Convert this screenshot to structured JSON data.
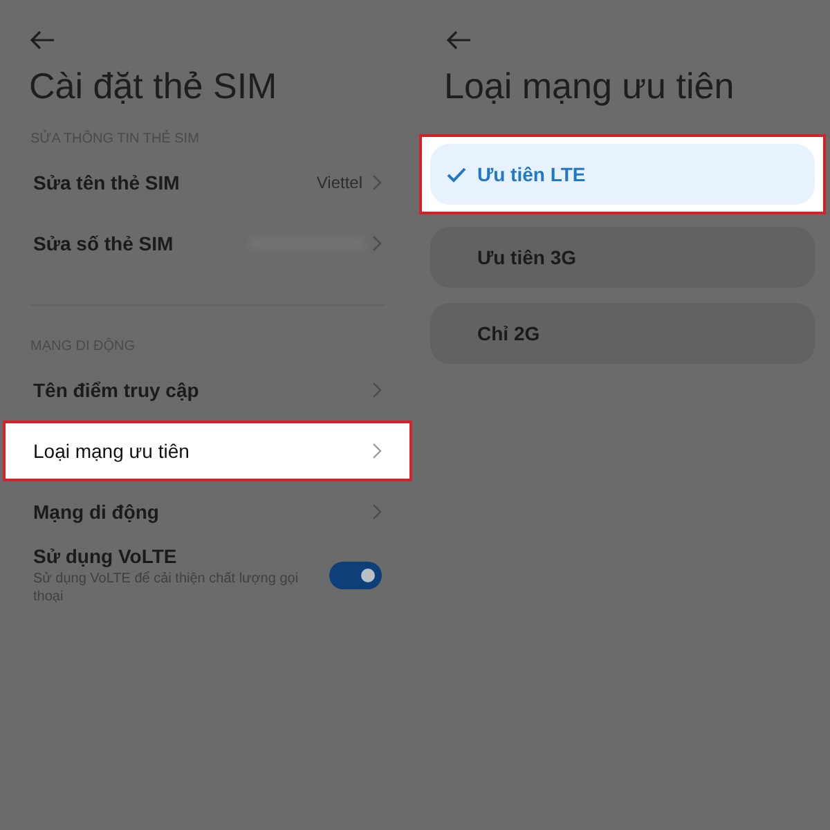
{
  "sim_settings": {
    "title": "Cài đặt thẻ SIM",
    "sections": [
      {
        "header": "SỬA THÔNG TIN THẺ SIM",
        "items": [
          {
            "kind": "link",
            "label": "Sửa tên thẻ SIM",
            "value": "Viettel",
            "highlighted": false
          },
          {
            "kind": "link",
            "label": "Sửa số thẻ SIM",
            "blurred_value": true,
            "highlighted": false
          }
        ]
      },
      {
        "header": "MẠNG DI ĐỘNG",
        "items": [
          {
            "kind": "link",
            "label": "Tên điểm truy cập",
            "highlighted": false
          },
          {
            "kind": "link",
            "label": "Loại mạng ưu tiên",
            "highlighted": true
          },
          {
            "kind": "link",
            "label": "Mạng di động",
            "highlighted": false
          },
          {
            "kind": "toggle",
            "label": "Sử dụng VoLTE",
            "description": "Sử dụng VoLTE để cải thiện chất lượng gọi thoại",
            "on": true,
            "highlighted": false
          }
        ]
      }
    ]
  },
  "network_type": {
    "title": "Loại mạng ưu tiên",
    "options": [
      {
        "label": "Ưu tiên LTE",
        "selected": true,
        "highlighted": true
      },
      {
        "label": "Ưu tiên 3G",
        "selected": false,
        "highlighted": false
      },
      {
        "label": "Chỉ 2G",
        "selected": false,
        "highlighted": false
      }
    ]
  }
}
